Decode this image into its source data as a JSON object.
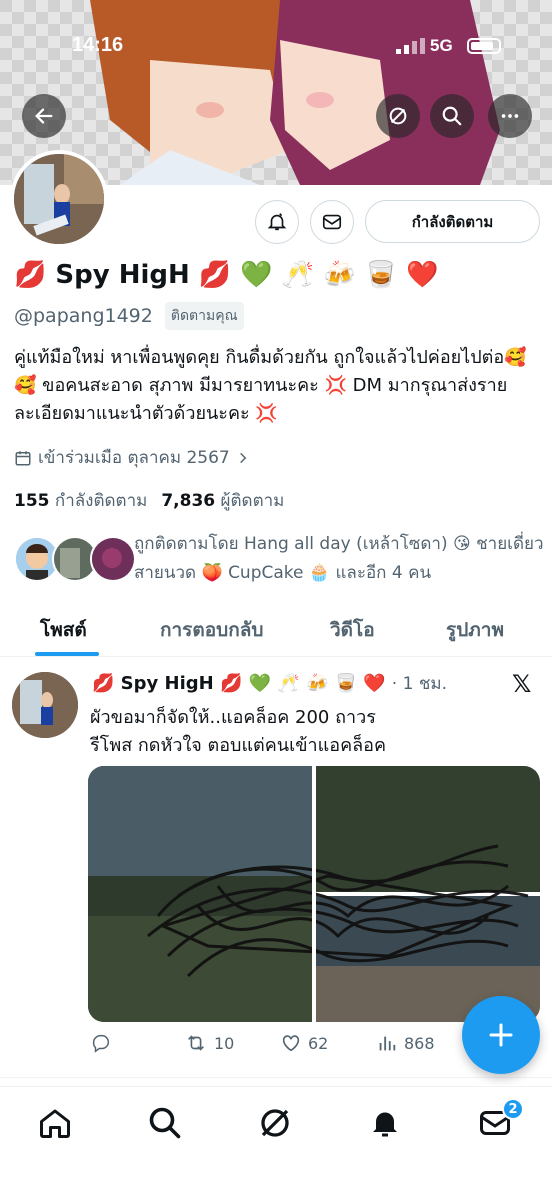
{
  "status": {
    "time": "14:16",
    "network": "5G"
  },
  "profile": {
    "name": "💋 Spy HigH 💋 💚 🥂 🍻 🥃 ❤️",
    "handle": "@papang1492",
    "follows_you": "ติดตามคุณ",
    "bio": "คู่แท้มือใหม่ หาเพื่อนพูดคุย กินดื่มด้วยกัน ถูกใจแล้วไปค่อยไปต่อ🥰🥰 ขอคนสะอาด สุภาพ มีมารยาทนะคะ 💢 DM มากรุณาส่งรายละเอียดมาแนะนำตัวด้วยนะคะ 💢",
    "joined": "เข้าร่วมเมือ ตุลาคม 2567",
    "following_count": "155",
    "following_label": "กำลังติดตาม",
    "followers_count": "7,836",
    "followers_label": "ผู้ติดตาม",
    "following_button": "กำลังติดตาม",
    "mutual_text": "ถูกติดตามโดย Hang all day (เหล้าโซดา) 😘 ชายเดี่ยวสายนวด 🍑 CupCake 🧁 และอีก 4 คน"
  },
  "tabs": [
    "โพสต์",
    "การตอบกลับ",
    "วิดีโอ",
    "รูปภาพ"
  ],
  "post": {
    "name": "💋 Spy HigH 💋 💚 🥂 🍻 🥃 ❤️",
    "time": "· 1 ชม.",
    "text_line1": "ผัวขอมาก็จัดให้..แอคล็อค 200 ถาวร",
    "text_line2": "รีโพส กดหัวใจ ตอบแต่คนเข้าแอคล็อค",
    "reposts": "10",
    "likes": "62",
    "views": "868"
  },
  "nav": {
    "notifications_badge": "2"
  },
  "colors": {
    "accent": "#1d9bf0",
    "secondary_text": "#536471"
  },
  "icons": [
    "back-arrow-icon",
    "grok-icon",
    "search-icon",
    "more-icon",
    "bell-icon",
    "mail-icon",
    "calendar-icon",
    "chevron-right-icon",
    "x-logo-icon",
    "reply-icon",
    "repost-icon",
    "like-icon",
    "views-icon",
    "plus-icon",
    "home-icon"
  ]
}
